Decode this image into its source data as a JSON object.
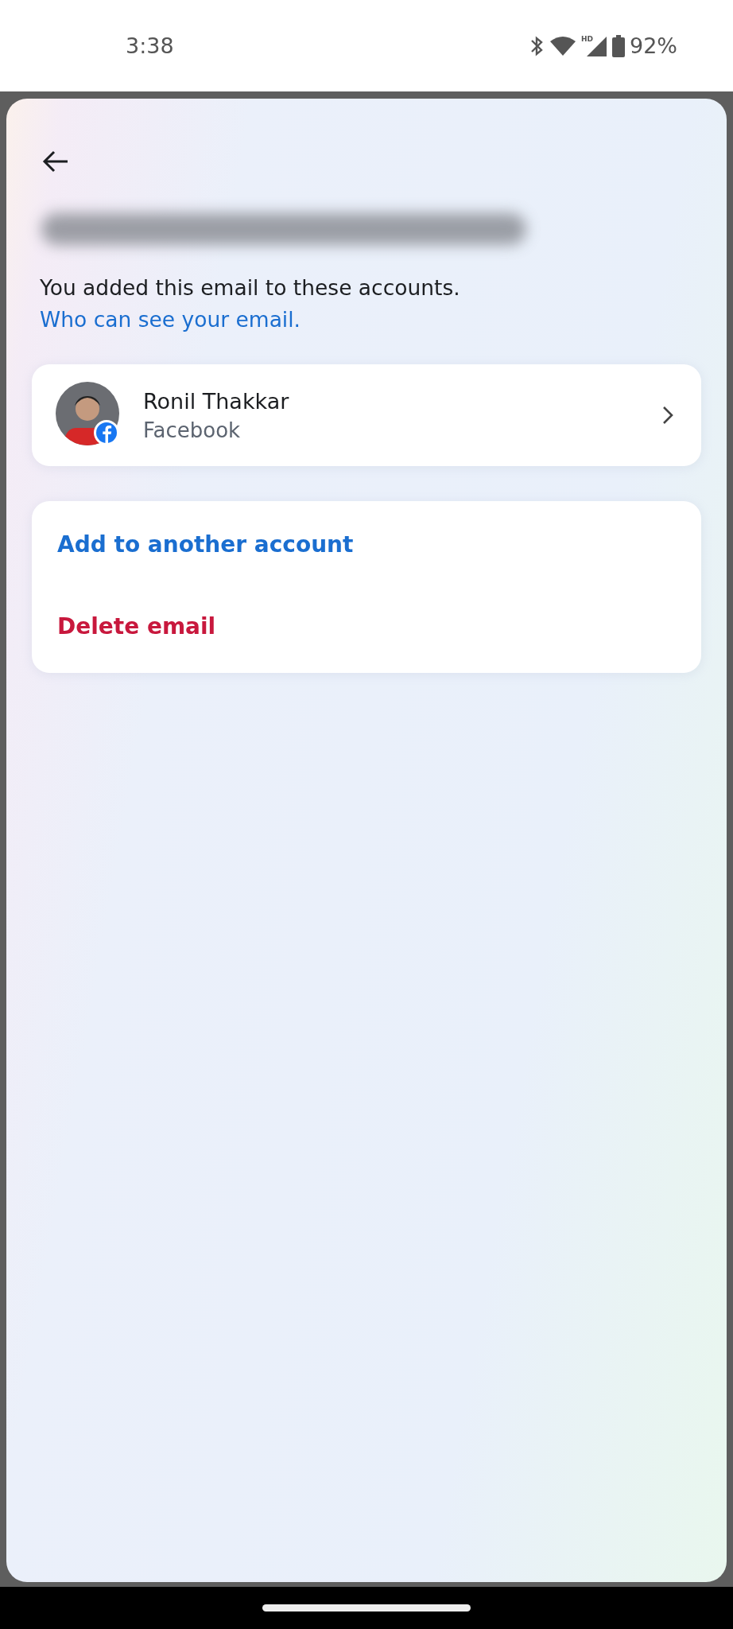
{
  "status_bar": {
    "time": "3:38",
    "battery": "92%",
    "network_badge": "HD"
  },
  "sheet": {
    "description": "You added this email to these accounts.",
    "link": "Who can see your email.",
    "accounts": [
      {
        "name": "Ronil Thakkar",
        "platform": "Facebook"
      }
    ],
    "actions": [
      {
        "label": "Add to another account",
        "kind": "primary"
      },
      {
        "label": "Delete email",
        "kind": "danger"
      }
    ]
  }
}
